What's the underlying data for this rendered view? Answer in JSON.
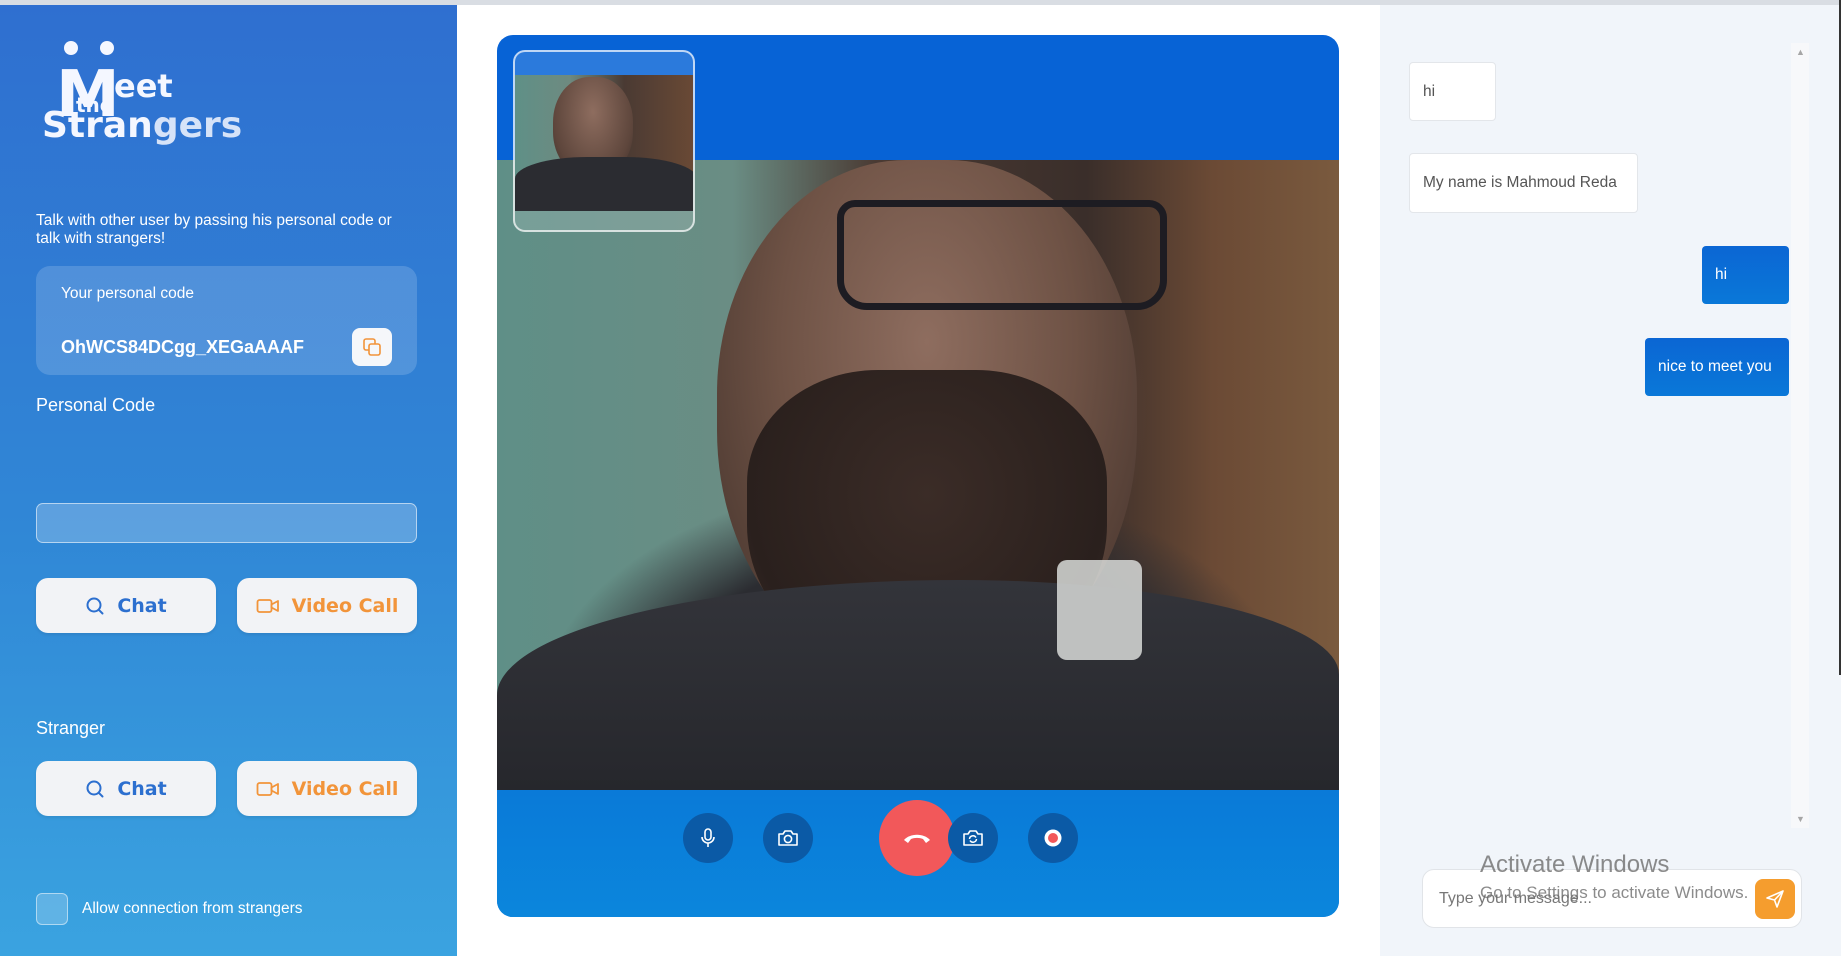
{
  "brand": {
    "logo_m": "M",
    "logo_eet": "eet",
    "logo_the": "the",
    "logo_strangers_a": "Stran",
    "logo_strangers_b": "gers"
  },
  "sidebar": {
    "intro": "Talk with other user by passing his personal code or talk with strangers!",
    "code_label": "Your personal code",
    "code_value": "OhWCS84DCgg_XEGaAAAF",
    "personal_code_heading": "Personal Code",
    "personal_code_input_value": "",
    "personal_chat_label": "Chat",
    "personal_video_label": "Video Call",
    "stranger_heading": "Stranger",
    "stranger_chat_label": "Chat",
    "stranger_video_label": "Video Call",
    "allow_label": "Allow connection from strangers"
  },
  "call": {
    "controls": [
      "microphone",
      "camera",
      "hang-up",
      "switch-camera",
      "record"
    ]
  },
  "chat": {
    "messages": [
      {
        "direction": "in",
        "text": "hi"
      },
      {
        "direction": "in",
        "text": "My name is Mahmoud Reda"
      },
      {
        "direction": "out",
        "text": "hi"
      },
      {
        "direction": "out",
        "text": "nice to meet you"
      }
    ],
    "input_placeholder": "Type your message...",
    "input_value": ""
  },
  "watermark": {
    "title": "Activate Windows",
    "subtitle": "Go to Settings to activate Windows."
  },
  "colors": {
    "sidebar_top": "#2f6fd0",
    "sidebar_bottom": "#3aa3e0",
    "call_panel": "#0763d6",
    "hangup": "#f2585a",
    "video_btn_text": "#f2943a",
    "chat_btn_text": "#2c6fcf",
    "send_btn": "#f59d2e"
  }
}
